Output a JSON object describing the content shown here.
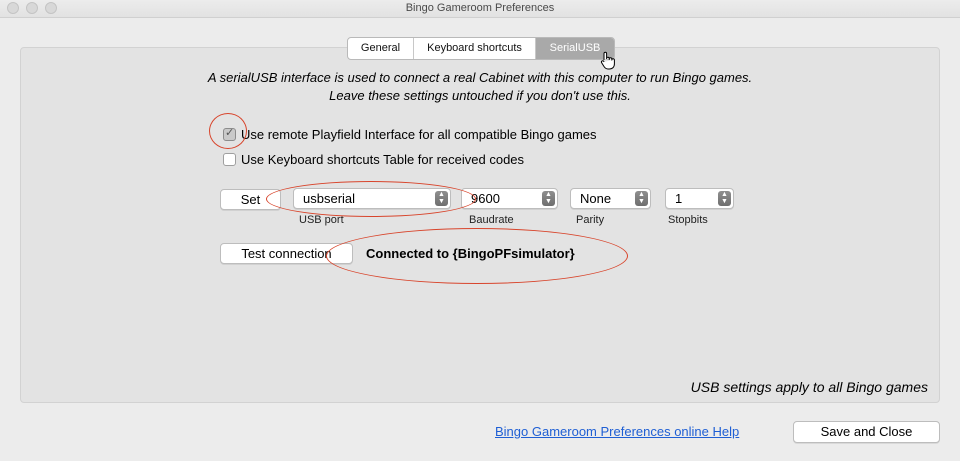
{
  "window": {
    "title": "Bingo Gameroom Preferences"
  },
  "tabs": [
    {
      "label": "General",
      "active": false
    },
    {
      "label": "Keyboard shortcuts",
      "active": false
    },
    {
      "label": "SerialUSB",
      "active": true
    }
  ],
  "description": {
    "line1": "A serialUSB interface is used to connect a real Cabinet with this computer to run Bingo games.",
    "line2": "Leave these settings untouched if you don't use this."
  },
  "options": {
    "remote_playfield": {
      "label": "Use remote Playfield Interface for all compatible Bingo games",
      "checked": true
    },
    "keyboard_table": {
      "label": "Use Keyboard shortcuts Table for received codes",
      "checked": false
    }
  },
  "serial": {
    "set_label": "Set",
    "usb_port": {
      "value": "usbserial",
      "caption": "USB port"
    },
    "baudrate": {
      "value": "9600",
      "caption": "Baudrate"
    },
    "parity": {
      "value": "None",
      "caption": "Parity"
    },
    "stopbits": {
      "value": "1",
      "caption": "Stopbits"
    }
  },
  "connection": {
    "test_label": "Test connection",
    "status": "Connected to {BingoPFsimulator}"
  },
  "footnote": "USB settings apply to all Bingo games",
  "footer": {
    "help_link": "Bingo Gameroom Preferences online Help",
    "save_close_label": "Save and Close"
  },
  "colors": {
    "annotation": "#d8452c",
    "active_tab": "#a9a9a9",
    "link": "#1f5fd4"
  }
}
